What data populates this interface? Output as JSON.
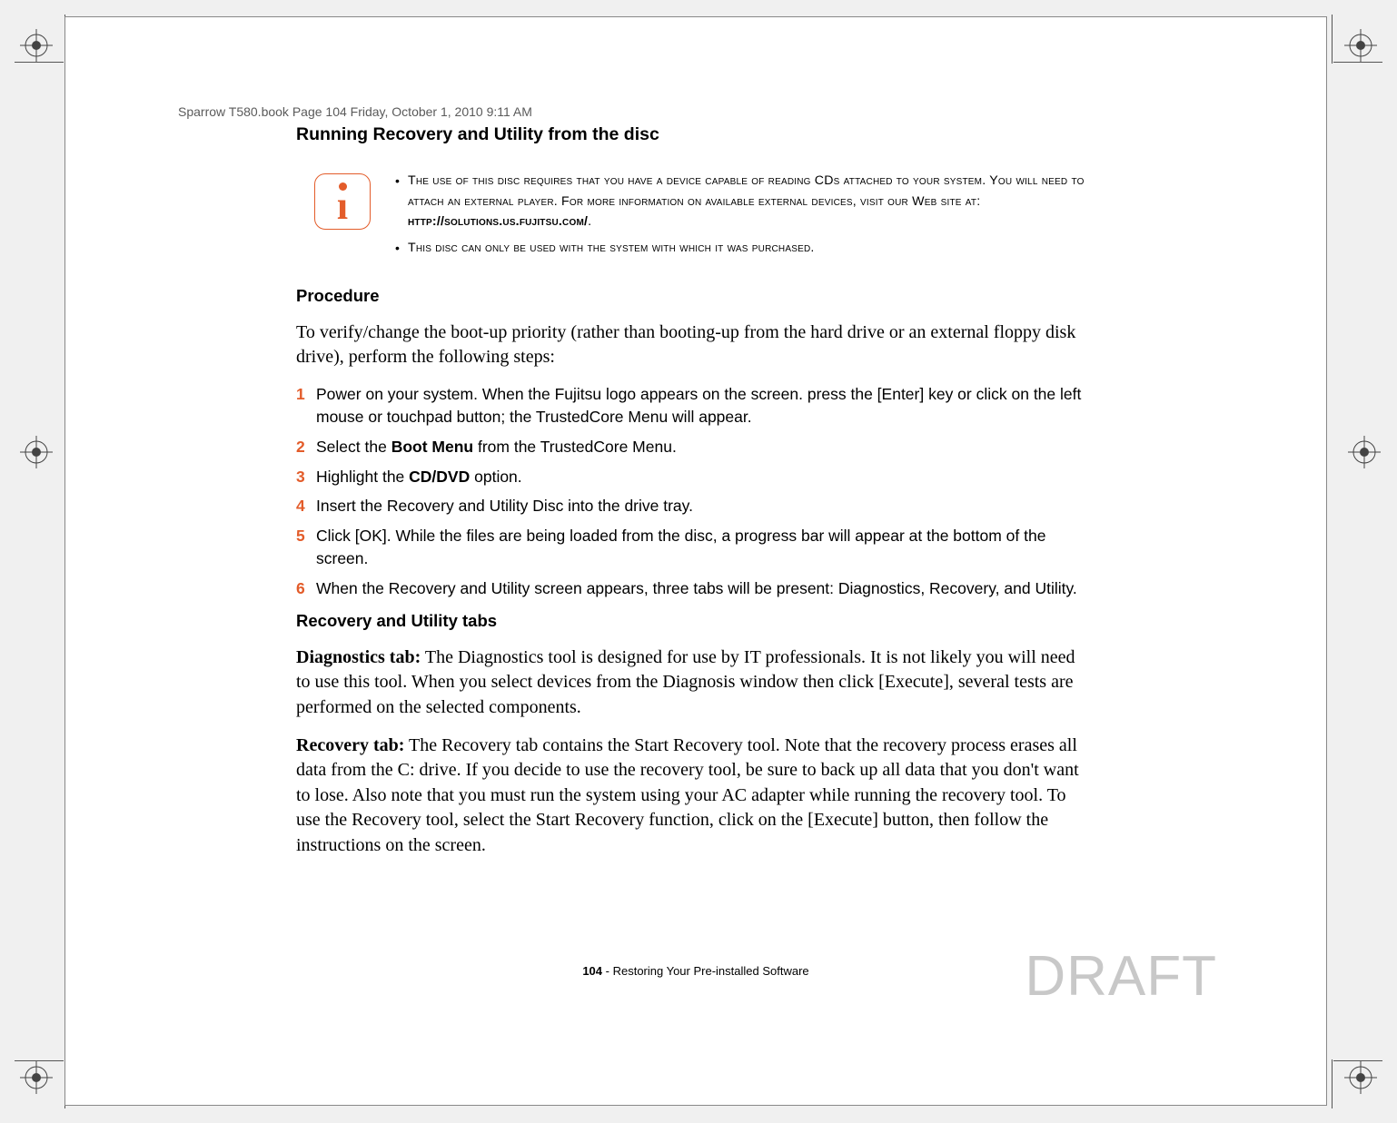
{
  "header_runner": "Sparrow T580.book  Page 104  Friday, October 1, 2010  9:11 AM",
  "section_title": "Running Recovery and Utility from the disc",
  "info_bullets": [
    "The use of this disc requires that you have a device capable of reading CDs attached to your system. You will need to attach an external player. For more information on available external devices, visit our Web site at: http://solutions.us.fujitsu.com/.",
    "This disc can only be used with the system with which it was purchased."
  ],
  "procedure_heading": "Procedure",
  "procedure_intro": "To verify/change the boot-up priority (rather than booting-up from the hard drive or an external floppy disk drive), perform the following steps:",
  "steps": [
    "Power on your system. When the Fujitsu logo appears on the screen. press the [Enter] key or click on the left mouse or touchpad button; the TrustedCore Menu will appear.",
    "Select the Boot Menu from the TrustedCore Menu.",
    "Highlight the CD/DVD option.",
    "Insert the Recovery and Utility Disc into the drive tray.",
    "Click [OK]. While the files are being loaded from the disc, a progress bar will appear at the bottom of the screen.",
    "When the Recovery and Utility screen appears, three tabs will be present: Diagnostics, Recovery, and Utility."
  ],
  "tabs_heading": "Recovery and Utility tabs",
  "diag_label": "Diagnostics tab:",
  "diag_body": " The Diagnostics tool is designed for use by IT professionals. It is not likely you will need to use this tool. When you select devices from the Diagnosis window then click [Execute], several tests are performed on the selected components.",
  "recov_label": "Recovery tab:",
  "recov_body": " The Recovery tab contains the Start Recovery tool. Note that the recovery process erases all data from the C: drive. If you decide to use the recovery tool, be sure to back up all data that you don't want to lose. Also note that you must run the system using your AC adapter while running the recovery tool. To use the Recovery tool, select the Start Recovery function, click on the [Execute] button, then follow the instructions on the screen.",
  "footer_page_num": "104",
  "footer_text": " - Restoring Your Pre-installed Software",
  "draft": "DRAFT"
}
